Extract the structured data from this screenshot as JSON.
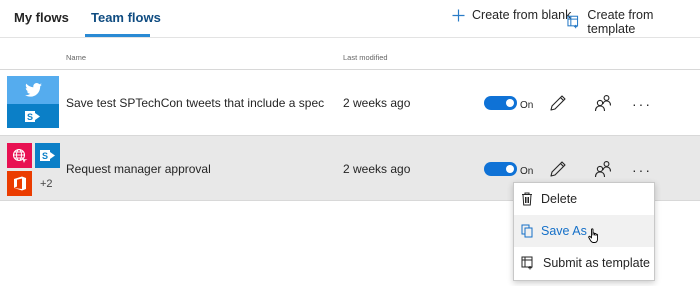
{
  "tabs": [
    {
      "label": "My flows",
      "active": false
    },
    {
      "label": "Team flows",
      "active": true
    }
  ],
  "actions": {
    "create_blank": "Create from blank",
    "create_template": "Create from template"
  },
  "columns": {
    "name": "Name",
    "modified": "Last modified"
  },
  "flows": [
    {
      "name": "Save test SPTechCon tweets that include a specific h",
      "modified": "2 weeks ago",
      "toggle_label": "On",
      "connectors": [
        "twitter-icon",
        "sharepoint-icon"
      ]
    },
    {
      "name": "Request manager approval",
      "modified": "2 weeks ago",
      "toggle_label": "On",
      "connectors": [
        "approval-globe-icon",
        "sharepoint-icon",
        "office-icon"
      ],
      "extra_count": "+2"
    }
  ],
  "context_menu": {
    "items": [
      {
        "label": "Delete",
        "icon": "trash-icon"
      },
      {
        "label": "Save As",
        "icon": "copy-icon",
        "hovered": true
      },
      {
        "label": "Submit as template",
        "icon": "template-icon"
      }
    ]
  },
  "colors": {
    "accent": "#2a8ad4",
    "toggle_on": "#0f72d6",
    "twitter": "#55acee",
    "sharepoint": "#0b7fc7",
    "approval": "#e81152",
    "office": "#eb3c00",
    "selected_row": "#e8e8e8"
  }
}
